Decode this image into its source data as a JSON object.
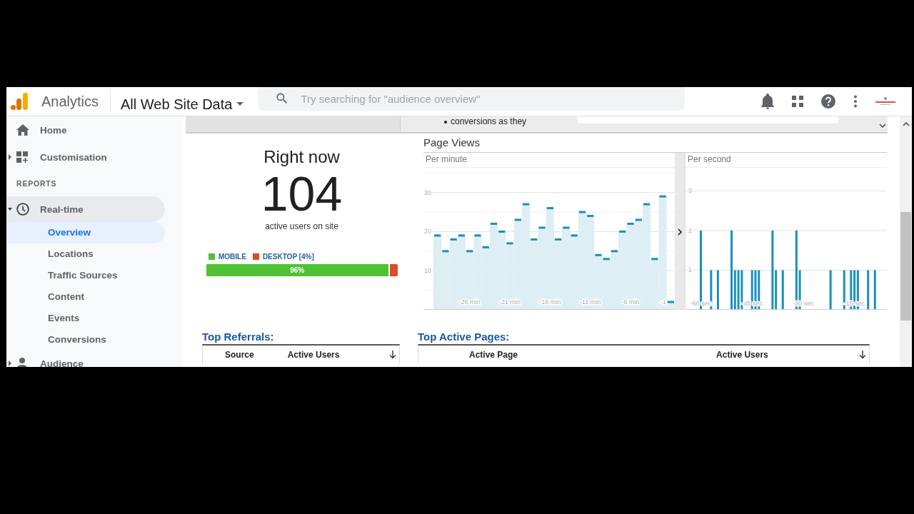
{
  "topbar": {
    "product": "Analytics",
    "view": "All Web Site Data",
    "search": {
      "placeholder": "Try searching for \"audience overview\""
    }
  },
  "sidebar": {
    "items": [
      {
        "kind": "link",
        "label": "Home",
        "selected": false
      },
      {
        "kind": "group",
        "label": "Customisation",
        "expanded": false,
        "selected": false
      },
      {
        "kind": "header",
        "label": "REPORTS"
      },
      {
        "kind": "group",
        "label": "Real-time",
        "expanded": true,
        "selected": true,
        "children": [
          {
            "label": "Overview",
            "selected": true
          },
          {
            "label": "Locations",
            "selected": false
          },
          {
            "label": "Traffic Sources",
            "selected": false
          },
          {
            "label": "Content",
            "selected": false
          },
          {
            "label": "Events",
            "selected": false
          },
          {
            "label": "Conversions",
            "selected": false
          }
        ]
      },
      {
        "kind": "group",
        "label": "Audience",
        "expanded": false,
        "selected": false
      }
    ]
  },
  "banner": {
    "bullet": "conversions as they"
  },
  "realtime": {
    "heading": "Right now",
    "count": "104",
    "caption": "active users on site",
    "legend": [
      {
        "label": "MOBILE",
        "color": "#4ec233"
      },
      {
        "label": "DESKTOP [4%]",
        "color": "#dc4a26"
      }
    ],
    "bar": {
      "level": 0.96,
      "label": "96%"
    }
  },
  "page_views": {
    "title": "Page Views",
    "per_minute": {
      "title": "Per minute",
      "chart_data": {
        "type": "bar",
        "grid": true,
        "ylim": [
          0,
          36.5
        ],
        "yticks": [
          10,
          20,
          30
        ],
        "xlim": [
          -30.5,
          -0.5
        ],
        "x": [
          -30,
          -29,
          -28,
          -27,
          -26,
          -25,
          -24,
          -23,
          -22,
          -21,
          -20,
          -19,
          -18,
          -17,
          -16,
          -15,
          -14,
          -13,
          -12,
          -11,
          -10,
          -9,
          -8,
          -7,
          -6,
          -5,
          -4,
          -3,
          -2,
          -1
        ],
        "xticks": [
          {
            "value": -26,
            "label": "-26 min"
          },
          {
            "value": -21,
            "label": "-21 min"
          },
          {
            "value": -16,
            "label": "-16 min"
          },
          {
            "value": -11,
            "label": "-11 min"
          },
          {
            "value": -6,
            "label": "-6 min"
          },
          {
            "value": -1,
            "label": "-1"
          }
        ],
        "series": [
          {
            "color": "#ddeef5",
            "values": [
              19,
              15,
              18,
              19,
              15,
              19,
              16,
              22,
              20,
              17,
              23,
              27,
              18,
              21,
              26,
              18,
              21,
              19,
              25,
              24,
              14,
              13,
              15,
              20,
              22,
              23,
              27,
              13,
              29,
              2
            ]
          }
        ]
      }
    },
    "per_second": {
      "title": "Per second",
      "chart_data": {
        "type": "bar",
        "grid": true,
        "ylim": [
          0,
          3.6
        ],
        "yticks": [
          1,
          2,
          3
        ],
        "xlim": [
          -64.5,
          -5.5
        ],
        "x": [
          -60,
          -59,
          -58,
          -57,
          -56,
          -55,
          -54,
          -53,
          -52,
          -51,
          -50,
          -49,
          -48,
          -47,
          -46,
          -45,
          -44,
          -43,
          -42,
          -41,
          -40,
          -39,
          -38,
          -37,
          -36,
          -35,
          -34,
          -33,
          -32,
          -31,
          -30,
          -29,
          -28,
          -27,
          -26,
          -25,
          -24,
          -23,
          -22,
          -21,
          -20,
          -19,
          -18,
          -17,
          -16,
          -15,
          -14,
          -13,
          -12,
          -11,
          -10,
          -9
        ],
        "xticks": [
          {
            "value": -60,
            "label": "-60 sec"
          },
          {
            "value": -45,
            "label": "-45 sec"
          },
          {
            "value": -30,
            "label": "-30 sec"
          },
          {
            "value": -15,
            "label": "-15 sec"
          }
        ],
        "series": [
          {
            "color": "#1a8fbf",
            "values": [
              2,
              null,
              null,
              1,
              null,
              1,
              null,
              null,
              null,
              2,
              1,
              1,
              1,
              null,
              null,
              1,
              1,
              1,
              null,
              null,
              null,
              2,
              1,
              null,
              1,
              null,
              null,
              null,
              2,
              1,
              null,
              null,
              null,
              null,
              null,
              null,
              null,
              null,
              1,
              null,
              null,
              null,
              1,
              null,
              1,
              1,
              1,
              null,
              null,
              1,
              null,
              1
            ]
          }
        ]
      }
    }
  },
  "tables": [
    {
      "title": "Top Referrals:",
      "columns": [
        "Source",
        "Active Users"
      ]
    },
    {
      "title": "Top Active Pages:",
      "columns": [
        "Active Page",
        "Active Users"
      ]
    }
  ]
}
